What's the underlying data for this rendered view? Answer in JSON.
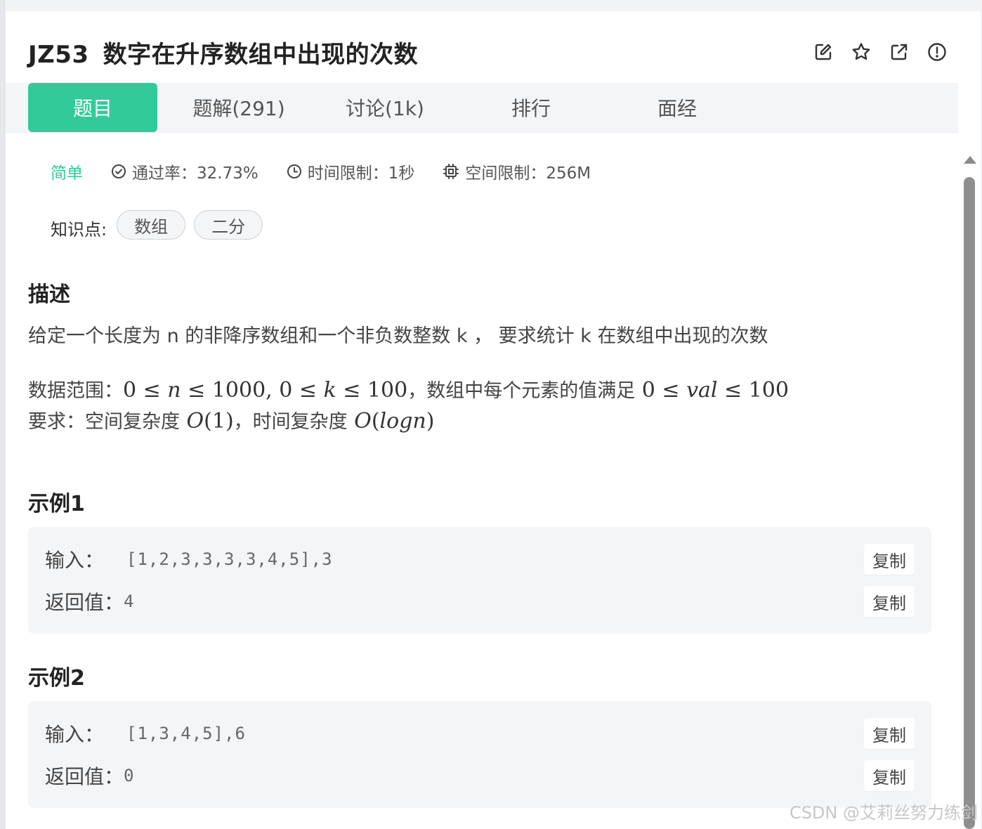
{
  "problem": {
    "code": "JZ53",
    "title": "数字在升序数组中出现的次数"
  },
  "header_icons": [
    "edit-icon",
    "star-icon",
    "external-link-icon",
    "info-icon"
  ],
  "tabs": [
    {
      "label": "题目",
      "active": true
    },
    {
      "label": "题解(291)",
      "active": false
    },
    {
      "label": "讨论(1k)",
      "active": false
    },
    {
      "label": "排行",
      "active": false
    },
    {
      "label": "面经",
      "active": false
    }
  ],
  "meta": {
    "difficulty": "简单",
    "pass_rate": "通过率：32.73%",
    "time_limit": "时间限制：1秒",
    "memory_limit": "空间限制：256M"
  },
  "knowledge": {
    "label": "知识点:",
    "tags": [
      "数组",
      "二分"
    ]
  },
  "description": {
    "heading": "描述",
    "line1": "给定一个长度为 n 的非降序数组和一个非负数整数 k ， 要求统计 k 在数组中出现的次数",
    "range_label": "数据范围：",
    "range_sep": "，数组中每个元素的值满足",
    "req_label": "要求：空间复杂度",
    "req_sep": "，时间复杂度"
  },
  "examples": [
    {
      "heading": "示例1",
      "input_label": "输入：",
      "input_value": "[1,2,3,3,3,3,4,5],3",
      "output_label": "返回值：",
      "output_value": "4",
      "copy_label": "复制"
    },
    {
      "heading": "示例2",
      "input_label": "输入：",
      "input_value": "[1,3,4,5],6",
      "output_label": "返回值：",
      "output_value": "0",
      "copy_label": "复制"
    }
  ],
  "watermark": "CSDN @艾莉丝努力练剑",
  "colors": {
    "accent": "#32ca99",
    "tab_bar": "#f4f5f7",
    "example_bg": "#f4f5f7"
  }
}
